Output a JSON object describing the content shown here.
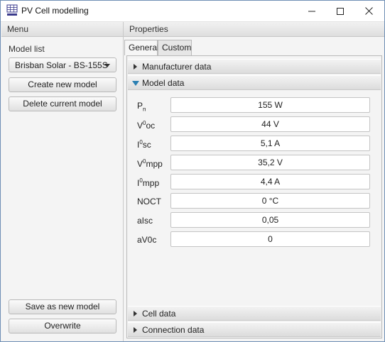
{
  "window": {
    "title": "PV Cell modelling",
    "icon": "pv-panel-icon",
    "controls": [
      "minimize",
      "maximize",
      "close"
    ]
  },
  "menu": {
    "header": "Menu",
    "model_list_label": "Model list",
    "selected_model": "Brisban Solar - BS-155S",
    "create_button": "Create new model",
    "delete_button": "Delete current model",
    "save_as_button": "Save as new model",
    "overwrite_button": "Overwrite"
  },
  "properties": {
    "header": "Properties",
    "tabs": [
      {
        "label": "General",
        "active": true
      },
      {
        "label": "Custom",
        "active": false
      }
    ],
    "sections": {
      "manufacturer": "Manufacturer data",
      "model": "Model data",
      "cell": "Cell data",
      "connection": "Connection data"
    },
    "fields": [
      {
        "label_main": "P",
        "label_sub": "n",
        "label_sup": "",
        "label_rest": "",
        "value": "155 W"
      },
      {
        "label_main": "V",
        "label_sub": "",
        "label_sup": "0",
        "label_rest": "oc",
        "value": "44 V"
      },
      {
        "label_main": "I",
        "label_sub": "",
        "label_sup": "0",
        "label_rest": "sc",
        "value": "5,1 A"
      },
      {
        "label_main": "V",
        "label_sub": "",
        "label_sup": "0",
        "label_rest": "mpp",
        "value": "35,2 V"
      },
      {
        "label_main": "I",
        "label_sub": "",
        "label_sup": "0",
        "label_rest": "mpp",
        "value": "4,4 A"
      },
      {
        "label_main": "NOCT",
        "label_sub": "",
        "label_sup": "",
        "label_rest": "",
        "value": "0 °C"
      },
      {
        "label_main": "aIsc",
        "label_sub": "",
        "label_sup": "",
        "label_rest": "",
        "value": "0,05"
      },
      {
        "label_main": "aV0c",
        "label_sub": "",
        "label_sup": "",
        "label_rest": "",
        "value": "0"
      }
    ]
  },
  "colors": {
    "accent_triangle": "#2a7fb2",
    "window_border": "#6f8fb5"
  }
}
